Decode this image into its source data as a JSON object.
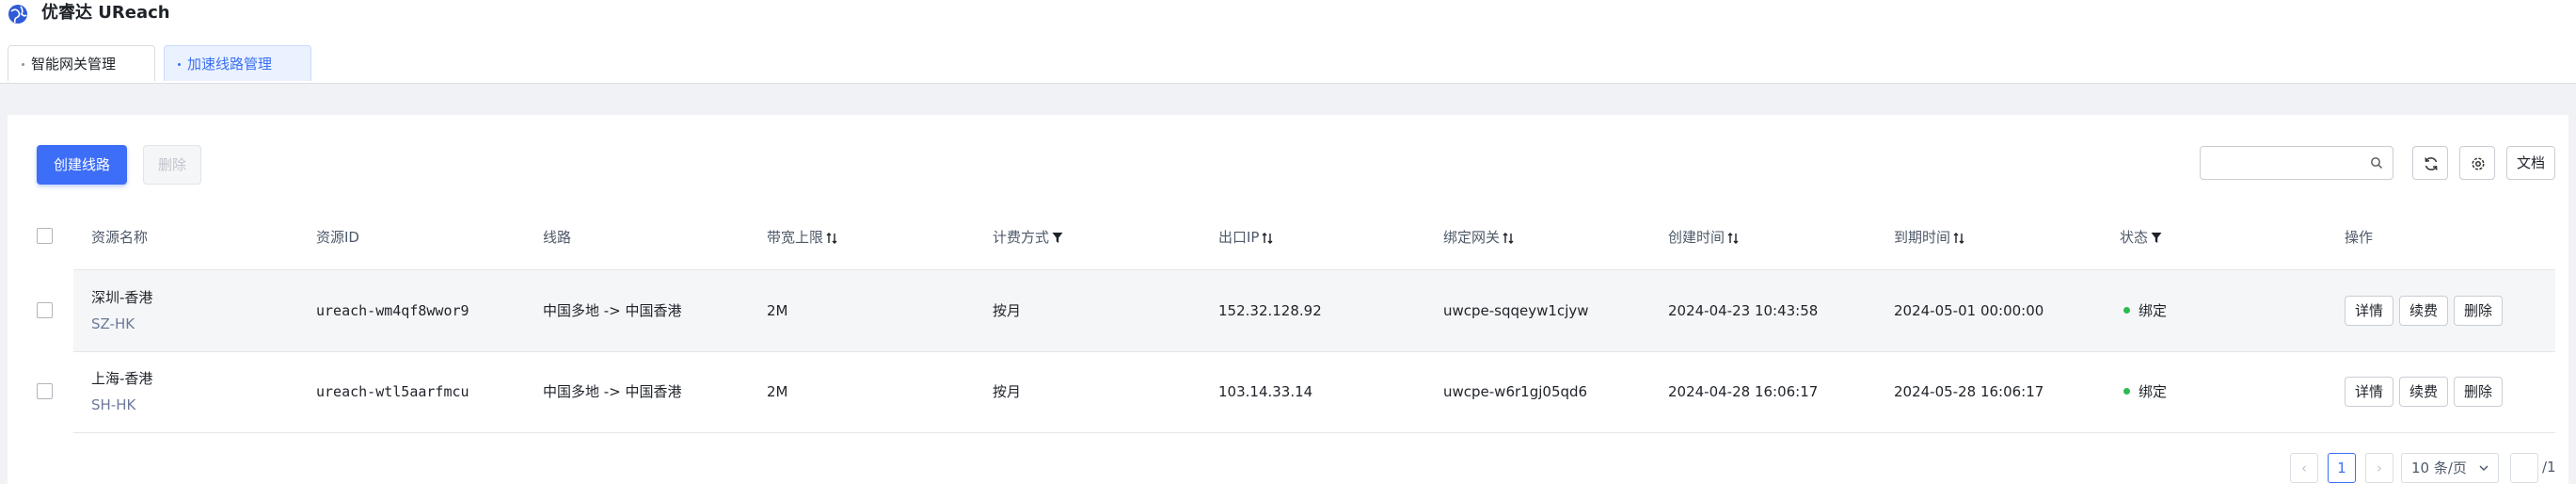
{
  "app": {
    "title": "优睿达 UReach",
    "logo": "globe-logo"
  },
  "tabs": [
    {
      "label": "智能网关管理",
      "active": false
    },
    {
      "label": "加速线路管理",
      "active": true
    }
  ],
  "toolbar": {
    "create_label": "创建线路",
    "delete_label": "删除",
    "search_placeholder": "",
    "refresh_icon": "refresh-icon",
    "settings_icon": "settings-icon",
    "docs_label": "文档"
  },
  "table": {
    "columns": [
      {
        "label": "资源名称",
        "indicator": ""
      },
      {
        "label": "资源ID",
        "indicator": ""
      },
      {
        "label": "线路",
        "indicator": ""
      },
      {
        "label": "带宽上限",
        "indicator": "sort"
      },
      {
        "label": "计费方式",
        "indicator": "filter"
      },
      {
        "label": "出口IP",
        "indicator": "sort"
      },
      {
        "label": "绑定网关",
        "indicator": "sort"
      },
      {
        "label": "创建时间",
        "indicator": "sort"
      },
      {
        "label": "到期时间",
        "indicator": "sort"
      },
      {
        "label": "状态",
        "indicator": "filter"
      },
      {
        "label": "操作",
        "indicator": ""
      }
    ],
    "rows": [
      {
        "name": "深圳-香港",
        "code": "SZ-HK",
        "id": "ureach-wm4qf8wwor9",
        "route": "中国多地 -> 中国香港",
        "bandwidth": "2M",
        "billing": "按月",
        "ip": "152.32.128.92",
        "gateway": "uwcpe-sqqeyw1cjyw",
        "created": "2024-04-23 10:43:58",
        "expires": "2024-05-01 00:00:00",
        "status": "绑定",
        "actions": [
          "详情",
          "续费",
          "删除"
        ]
      },
      {
        "name": "上海-香港",
        "code": "SH-HK",
        "id": "ureach-wtl5aarfmcu",
        "route": "中国多地 -> 中国香港",
        "bandwidth": "2M",
        "billing": "按月",
        "ip": "103.14.33.14",
        "gateway": "uwcpe-w6r1gj05qd6",
        "created": "2024-04-28 16:06:17",
        "expires": "2024-05-28 16:06:17",
        "status": "绑定",
        "actions": [
          "详情",
          "续费",
          "删除"
        ]
      }
    ]
  },
  "pagination": {
    "prev": "‹",
    "current_page": "1",
    "next": "›",
    "page_size": "10 条/页",
    "jump_value": "",
    "total_pages": "/1"
  },
  "colors": {
    "primary": "#3d6ef7",
    "status_ok": "#2dbb4f",
    "row_highlight": "#f5f6f8"
  }
}
